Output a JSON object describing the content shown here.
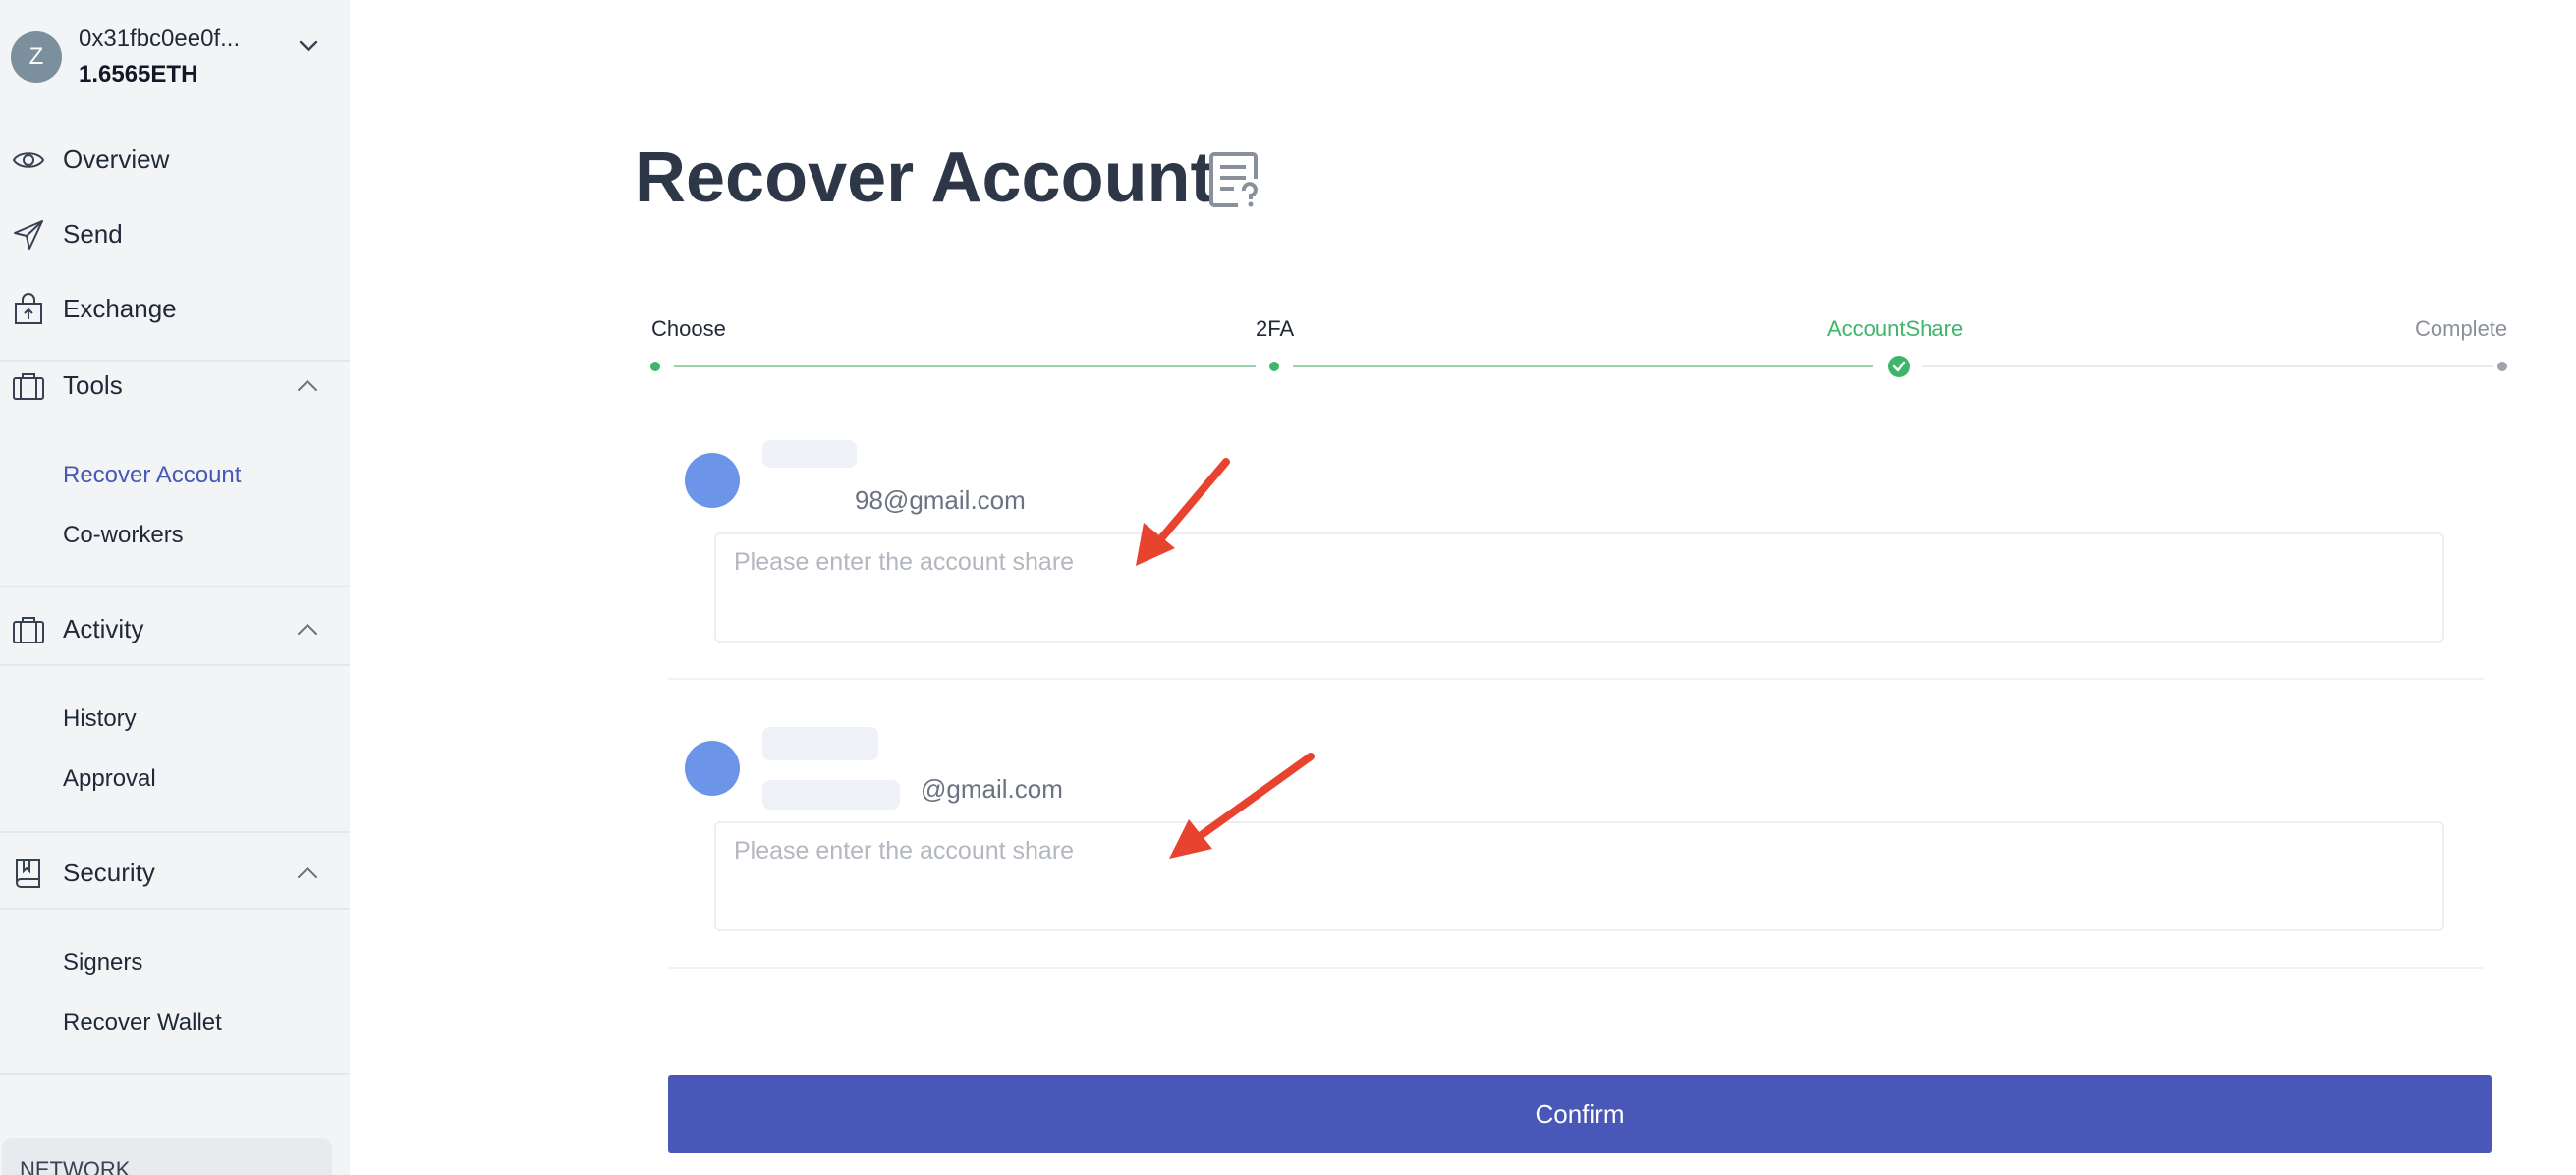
{
  "account": {
    "avatar_letter": "Z",
    "address": "0x31fbc0ee0f...",
    "balance": "1.6565ETH"
  },
  "nav": {
    "overview": "Overview",
    "send": "Send",
    "exchange": "Exchange",
    "tools": "Tools",
    "tools_items": [
      "Recover Account",
      "Co-workers"
    ],
    "activity": "Activity",
    "activity_items": [
      "History",
      "Approval"
    ],
    "security": "Security",
    "security_items": [
      "Signers",
      "Recover Wallet"
    ],
    "network_label": "NETWORK"
  },
  "page": {
    "title": "Recover Account",
    "title_icon": "help-document-icon"
  },
  "steps": [
    {
      "label": "Choose",
      "status": "done"
    },
    {
      "label": "2FA",
      "status": "done"
    },
    {
      "label": "AccountShare",
      "status": "current"
    },
    {
      "label": "Complete",
      "status": "pending"
    }
  ],
  "shares": [
    {
      "email": "98@gmail.com",
      "placeholder": "Please enter the account share",
      "value": ""
    },
    {
      "email": "@gmail.com",
      "placeholder": "Please enter the account share",
      "value": ""
    }
  ],
  "confirm_label": "Confirm",
  "colors": {
    "accent": "#4957b8",
    "active_nav": "#4657b6",
    "step_done": "#3fb56b",
    "avatar": "#6c95ea",
    "annotation_arrow": "#e8432e"
  }
}
